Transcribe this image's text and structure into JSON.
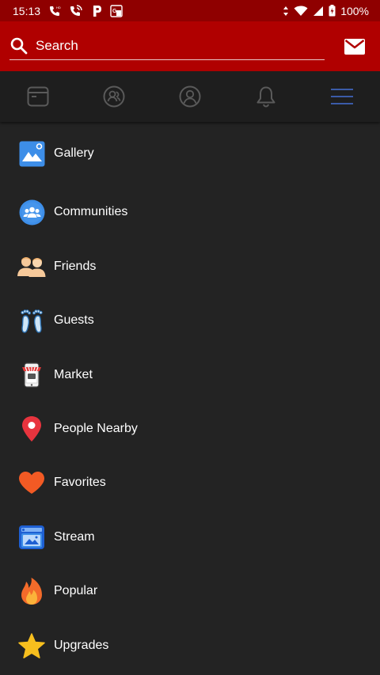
{
  "status_bar": {
    "time": "15:13",
    "battery": "100%"
  },
  "search": {
    "placeholder": "Search"
  },
  "tabs": [
    {
      "icon": "feed-icon"
    },
    {
      "icon": "contacts-icon"
    },
    {
      "icon": "profile-icon"
    },
    {
      "icon": "bell-icon"
    },
    {
      "icon": "hamburger-menu-icon",
      "active": true
    }
  ],
  "menu": {
    "items": [
      {
        "label": "Gallery",
        "icon": "gallery-icon"
      },
      {
        "label": "Communities",
        "icon": "communities-icon"
      },
      {
        "label": "Friends",
        "icon": "friends-icon"
      },
      {
        "label": "Guests",
        "icon": "footprints-icon"
      },
      {
        "label": "Market",
        "icon": "market-icon"
      },
      {
        "label": "People Nearby",
        "icon": "location-pin-icon"
      },
      {
        "label": "Favorites",
        "icon": "heart-icon"
      },
      {
        "label": "Stream",
        "icon": "stream-icon"
      },
      {
        "label": "Popular",
        "icon": "flame-icon"
      },
      {
        "label": "Upgrades",
        "icon": "star-icon"
      }
    ]
  },
  "colors": {
    "status_bar": "#8f0000",
    "header": "#b00000",
    "tab_bar": "#1e1e1e",
    "background": "#232323",
    "active_tab": "#3b5ba8"
  }
}
